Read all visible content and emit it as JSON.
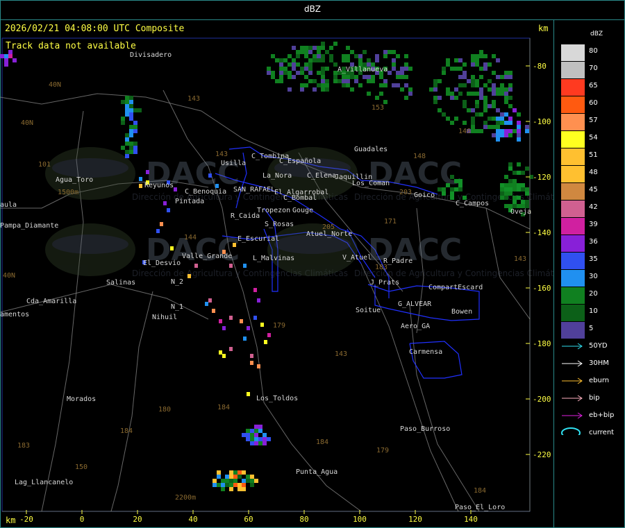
{
  "window": {
    "title": "dBZ"
  },
  "header": {
    "timestamp_text": "2026/02/21 04:08:00 UTC Composite",
    "km_label_top": "km",
    "km_label_bottom": "km"
  },
  "notice": "Track data not available",
  "x_ticks": [
    "-20",
    "0",
    "20",
    "40",
    "60",
    "80",
    "100",
    "120",
    "140"
  ],
  "y_ticks": [
    "-80",
    "-100",
    "-120",
    "-140",
    "-160",
    "-180",
    "-200",
    "-220"
  ],
  "places": [
    "Divisadero",
    "A_Villanueva",
    "Guadales",
    "C_Tombina",
    "Usilla",
    "C_Española",
    "C_Elena",
    "Jaquillin",
    "Los_Coman",
    "Goico",
    "C_Campos",
    "Agua_Toro",
    "Reyunos",
    "Pintada",
    "C_Benoquia",
    "SAN_RAFAEL",
    "La_Nora",
    "El_Algarrobal",
    "C_Bombal",
    "R_Caida",
    "Tropezon",
    "Gouge",
    "S_Rosas",
    "Atuel_Norte",
    "E_Escurial",
    "Valle_Grande",
    "L_Malvinas",
    "V_Atuel",
    "R_Padre",
    "El_Desvio",
    "Salinas",
    "N_2",
    "N_1",
    "Nihuil",
    "J_Prats",
    "CompartEscard",
    "G_ALVEAR",
    "Bowen",
    "Soitue",
    "Aero_GA",
    "Carmensa",
    "Cda_Amarilla",
    "amentos",
    "aula",
    "Pampa_Diamante",
    "Morados",
    "Los_Toldos",
    "Paso_Burroso",
    "Punta_Agua",
    "Lag_Llancanelo",
    "Paso_El_Loro",
    "Oveja"
  ],
  "grid_labels": [
    "40N",
    "40N",
    "101",
    "143",
    "153",
    "143",
    "148",
    "203",
    "146",
    "171",
    "144",
    "183",
    "179",
    "143",
    "184",
    "184",
    "180",
    "184",
    "179",
    "150",
    "183",
    "184",
    "143",
    "205",
    "40N"
  ],
  "watermark": {
    "text": "DACC",
    "subtitle": "Dirección de Agricultura y Contingencias Climáticas"
  },
  "elevation_labels": [
    "1500m",
    "2200m"
  ],
  "legend": {
    "title": "dBZ",
    "scale": [
      {
        "value": "80",
        "color": "#d8d8d8"
      },
      {
        "value": "70",
        "color": "#c0c0c0"
      },
      {
        "value": "65",
        "color": "#ff3a20"
      },
      {
        "value": "60",
        "color": "#ff5a10"
      },
      {
        "value": "57",
        "color": "#ff9050"
      },
      {
        "value": "54",
        "color": "#ffff20"
      },
      {
        "value": "51",
        "color": "#ffc030"
      },
      {
        "value": "48",
        "color": "#ffc030"
      },
      {
        "value": "45",
        "color": "#d08840"
      },
      {
        "value": "42",
        "color": "#d06090"
      },
      {
        "value": "39",
        "color": "#d020a0"
      },
      {
        "value": "36",
        "color": "#8820d8"
      },
      {
        "value": "35",
        "color": "#3050f0"
      },
      {
        "value": "30",
        "color": "#2090f0"
      },
      {
        "value": "20",
        "color": "#108020"
      },
      {
        "value": "10",
        "color": "#0c6018"
      },
      {
        "value": "5",
        "color": "#50409a"
      }
    ],
    "tracks": [
      {
        "label": "50YD",
        "color": "#30e0f0"
      },
      {
        "label": "30HM",
        "color": "#ffffff"
      },
      {
        "label": "eburn",
        "color": "#ffc030"
      },
      {
        "label": "bip",
        "color": "#ffb0c0"
      },
      {
        "label": "eb+bip",
        "color": "#e020e0"
      },
      {
        "label": "current",
        "color": "#30e0f0"
      }
    ]
  },
  "colors": {
    "axis": "#ffff44",
    "panel_border": "#2a8a8a",
    "boundary": "#2030ff",
    "route": "#8a8a8a",
    "grid_text": "#8a6a30"
  }
}
